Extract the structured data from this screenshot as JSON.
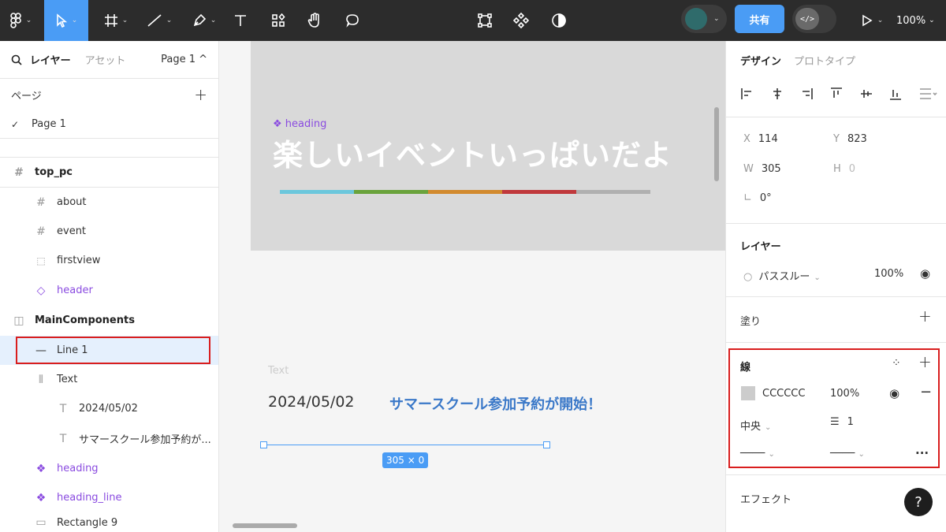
{
  "toolbar": {
    "tools": [
      "main-menu",
      "move-tool",
      "frame-tool",
      "line-tool",
      "pen-tool",
      "text-tool",
      "resources",
      "hand-tool",
      "comment-tool"
    ],
    "center_tools": [
      "edit-object",
      "component",
      "mask"
    ],
    "share_label": "共有",
    "zoom": "100%",
    "dev_mode_icon": "</>"
  },
  "left_panel": {
    "tab_layers": "レイヤー",
    "tab_assets": "アセット",
    "page_selector": "Page 1 ^",
    "pages_header": "ページ",
    "pages": [
      "Page 1"
    ],
    "layers": [
      {
        "label": "top_pc",
        "icon": "frame-icon"
      },
      {
        "label": "about",
        "icon": "frame-icon"
      },
      {
        "label": "event",
        "icon": "frame-icon"
      },
      {
        "label": "firstview",
        "icon": "section-icon"
      },
      {
        "label": "header",
        "icon": "instance-icon"
      },
      {
        "label": "MainComponents",
        "icon": "section-icon"
      },
      {
        "label": "Line 1",
        "icon": "line-icon"
      },
      {
        "label": "Text",
        "icon": "auto-layout-icon"
      },
      {
        "label": "2024/05/02",
        "icon": "text-icon"
      },
      {
        "label": "サマースクール参加予約が...",
        "icon": "text-icon"
      },
      {
        "label": "heading",
        "icon": "instance-icon"
      },
      {
        "label": "heading_line",
        "icon": "instance-icon"
      },
      {
        "label": "Rectangle 9",
        "icon": "rectangle-icon"
      }
    ]
  },
  "canvas": {
    "heading_label": "heading",
    "heading_title": "楽しいイベントいっぱいだよ",
    "color_bar": [
      "#6cc7dc",
      "#6aa33c",
      "#d28a2e",
      "#c0393c",
      "#b0b0b0"
    ],
    "text_frame_label": "Text",
    "date": "2024/05/02",
    "news_title": "サマースクール参加予約が開始！",
    "dimension_badge": "305 × 0"
  },
  "right_panel": {
    "tab_design": "デザイン",
    "tab_prototype": "プロトタイプ",
    "x_label": "X",
    "x_value": "114",
    "y_label": "Y",
    "y_value": "823",
    "w_label": "W",
    "w_value": "305",
    "h_label": "H",
    "h_value": "0",
    "rotation_value": "0°",
    "layer_title": "レイヤー",
    "blend_mode": "パススルー",
    "layer_opacity": "100%",
    "fill_title": "塗り",
    "stroke_title": "線",
    "stroke_color": "CCCCCC",
    "stroke_opacity": "100%",
    "stroke_position": "中央",
    "stroke_weight": "1",
    "effects_title": "エフェクト",
    "help": "?"
  }
}
